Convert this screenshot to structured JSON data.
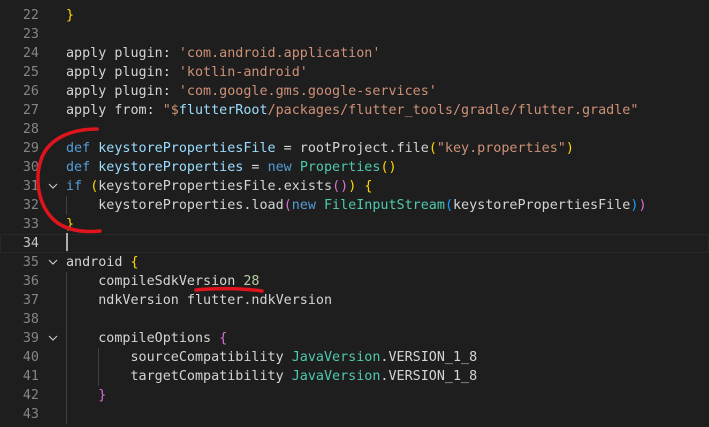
{
  "editor": {
    "lines": [
      {
        "num": "22",
        "fold": false,
        "tokens": [
          {
            "t": "}",
            "c": "br1"
          }
        ]
      },
      {
        "num": "23",
        "fold": false,
        "tokens": []
      },
      {
        "num": "24",
        "fold": false,
        "tokens": [
          {
            "t": "apply plugin: ",
            "c": "plain"
          },
          {
            "t": "'com.android.application'",
            "c": "str"
          }
        ]
      },
      {
        "num": "25",
        "fold": false,
        "tokens": [
          {
            "t": "apply plugin: ",
            "c": "plain"
          },
          {
            "t": "'kotlin-android'",
            "c": "str"
          }
        ]
      },
      {
        "num": "26",
        "fold": false,
        "tokens": [
          {
            "t": "apply plugin: ",
            "c": "plain"
          },
          {
            "t": "'com.google.gms.google-services'",
            "c": "str"
          }
        ]
      },
      {
        "num": "27",
        "fold": false,
        "tokens": [
          {
            "t": "apply from: ",
            "c": "plain"
          },
          {
            "t": "\"$",
            "c": "str"
          },
          {
            "t": "flutterRoot",
            "c": "var"
          },
          {
            "t": "/packages/flutter_tools/gradle/flutter.gradle\"",
            "c": "str"
          }
        ]
      },
      {
        "num": "28",
        "fold": false,
        "tokens": []
      },
      {
        "num": "29",
        "fold": false,
        "tokens": [
          {
            "t": "def ",
            "c": "kw"
          },
          {
            "t": "keystorePropertiesFile",
            "c": "var"
          },
          {
            "t": " = rootProject.",
            "c": "plain"
          },
          {
            "t": "file",
            "c": "plain"
          },
          {
            "t": "(",
            "c": "br1"
          },
          {
            "t": "\"key.properties\"",
            "c": "str"
          },
          {
            "t": ")",
            "c": "br1"
          }
        ]
      },
      {
        "num": "30",
        "fold": false,
        "tokens": [
          {
            "t": "def ",
            "c": "kw"
          },
          {
            "t": "keystoreProperties",
            "c": "var"
          },
          {
            "t": " = ",
            "c": "plain"
          },
          {
            "t": "new ",
            "c": "kw"
          },
          {
            "t": "Properties",
            "c": "cls"
          },
          {
            "t": "()",
            "c": "br1"
          }
        ]
      },
      {
        "num": "31",
        "fold": true,
        "tokens": [
          {
            "t": "if ",
            "c": "kw"
          },
          {
            "t": "(",
            "c": "br1"
          },
          {
            "t": "keystorePropertiesFile.",
            "c": "plain"
          },
          {
            "t": "exists",
            "c": "plain"
          },
          {
            "t": "()",
            "c": "br2"
          },
          {
            "t": ")",
            "c": "br1"
          },
          {
            "t": " ",
            "c": "plain"
          },
          {
            "t": "{",
            "c": "br1"
          }
        ]
      },
      {
        "num": "32",
        "fold": false,
        "tokens": [
          {
            "t": "    keystoreProperties.",
            "c": "plain"
          },
          {
            "t": "load",
            "c": "plain"
          },
          {
            "t": "(",
            "c": "br2"
          },
          {
            "t": "new ",
            "c": "kw"
          },
          {
            "t": "FileInputStream",
            "c": "cls"
          },
          {
            "t": "(",
            "c": "br3"
          },
          {
            "t": "keystorePropertiesFile",
            "c": "plain"
          },
          {
            "t": ")",
            "c": "br3"
          },
          {
            "t": ")",
            "c": "br2"
          }
        ]
      },
      {
        "num": "33",
        "fold": false,
        "tokens": [
          {
            "t": "}",
            "c": "br1"
          }
        ]
      },
      {
        "num": "34",
        "fold": false,
        "tokens": []
      },
      {
        "num": "35",
        "fold": true,
        "tokens": [
          {
            "t": "android ",
            "c": "plain"
          },
          {
            "t": "{",
            "c": "br1"
          }
        ]
      },
      {
        "num": "36",
        "fold": false,
        "tokens": [
          {
            "t": "    compileSdkVersion ",
            "c": "plain"
          },
          {
            "t": "28",
            "c": "num"
          }
        ]
      },
      {
        "num": "37",
        "fold": false,
        "tokens": [
          {
            "t": "    ndkVersion flutter.ndkVersion",
            "c": "plain"
          }
        ]
      },
      {
        "num": "38",
        "fold": false,
        "tokens": []
      },
      {
        "num": "39",
        "fold": true,
        "tokens": [
          {
            "t": "    compileOptions ",
            "c": "plain"
          },
          {
            "t": "{",
            "c": "br2"
          }
        ]
      },
      {
        "num": "40",
        "fold": false,
        "tokens": [
          {
            "t": "        sourceCompatibility ",
            "c": "plain"
          },
          {
            "t": "JavaVersion",
            "c": "cls"
          },
          {
            "t": ".VERSION_1_8",
            "c": "plain"
          }
        ]
      },
      {
        "num": "41",
        "fold": false,
        "tokens": [
          {
            "t": "        targetCompatibility ",
            "c": "plain"
          },
          {
            "t": "JavaVersion",
            "c": "cls"
          },
          {
            "t": ".VERSION_1_8",
            "c": "plain"
          }
        ]
      },
      {
        "num": "42",
        "fold": false,
        "tokens": [
          {
            "t": "    }",
            "c": "br2"
          }
        ]
      },
      {
        "num": "43",
        "fold": false,
        "tokens": []
      }
    ],
    "current_line": "34"
  },
  "colors": {
    "background": "#1e1e1e",
    "annotation": "#e0141c"
  }
}
